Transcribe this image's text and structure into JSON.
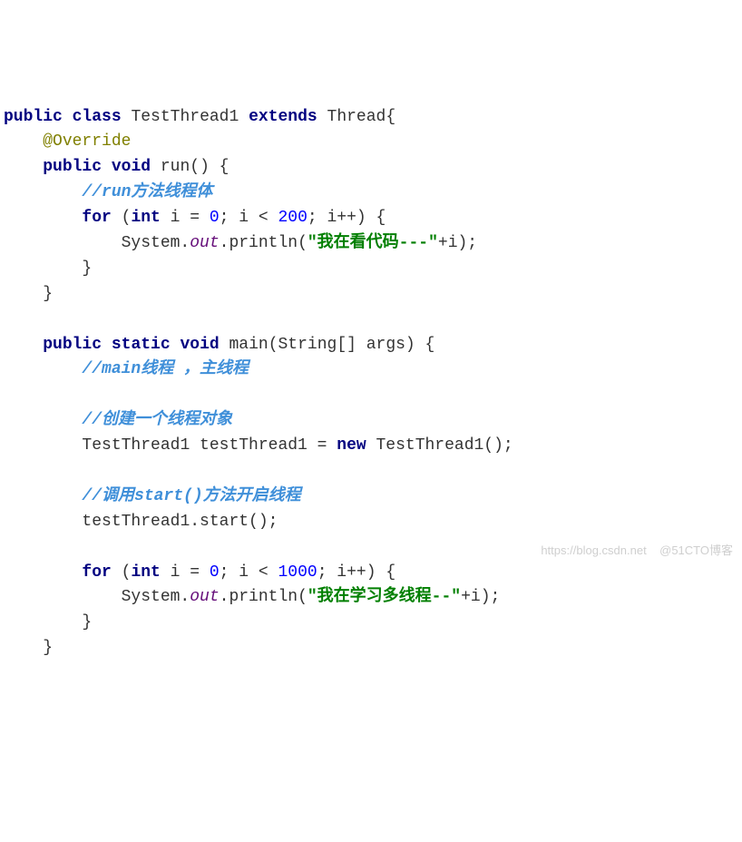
{
  "code": {
    "l1": {
      "kw1": "public",
      "kw2": "class",
      "name": "TestThread1",
      "kw3": "extends",
      "sup": "Thread{"
    },
    "l2": {
      "ann": "@Override"
    },
    "l3": {
      "kw1": "public",
      "kw2": "void",
      "name": "run() {"
    },
    "l4": {
      "c": "//run方法线程体"
    },
    "l5": {
      "kw1": "for",
      "open": " (",
      "kw2": "int",
      "var": " i = ",
      "n0": "0",
      "mid": "; i < ",
      "n1": "200",
      "end": "; i++) {"
    },
    "l6": {
      "pre": "System.",
      "out": "out",
      "call": ".println(",
      "str": "\"我在看代码---\"",
      "post": "+i);"
    },
    "l7": {
      "brace": "}"
    },
    "l8": {
      "brace": "}"
    },
    "l9": {
      "kw1": "public",
      "kw2": "static",
      "kw3": "void",
      "name": "main(String[] args) {"
    },
    "l10": {
      "c": "//main线程 ，主线程"
    },
    "l11": {
      "c": "//创建一个线程对象"
    },
    "l12": {
      "a": "TestThread1 testThread1 = ",
      "kw": "new",
      "b": " TestThread1();"
    },
    "l13": {
      "c": "//调用start()方法开启线程"
    },
    "l14": {
      "t": "testThread1.start();"
    },
    "l15": {
      "kw1": "for",
      "open": " (",
      "kw2": "int",
      "var": " i = ",
      "n0": "0",
      "mid": "; i < ",
      "n1": "1000",
      "end": "; i++) {"
    },
    "l16": {
      "pre": "System.",
      "out": "out",
      "call": ".println(",
      "str": "\"我在学习多线程--\"",
      "post": "+i);"
    },
    "l17": {
      "brace": "}"
    },
    "l18": {
      "brace": "}"
    }
  },
  "watermark": "https://blog.csdn.net    @51CTO博客"
}
